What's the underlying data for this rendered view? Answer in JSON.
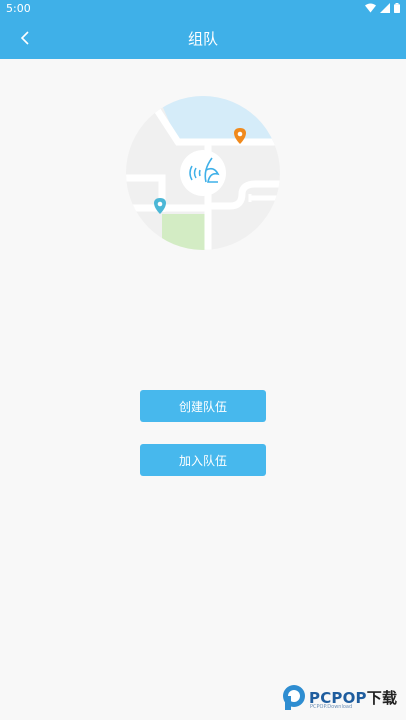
{
  "status_bar": {
    "time": "5:00"
  },
  "app_bar": {
    "title": "组队",
    "back_icon": "chevron-left-icon"
  },
  "illustration": {
    "icon": "team-location-map-icon"
  },
  "actions": {
    "create_team": "创建队伍",
    "join_team": "加入队伍"
  },
  "watermark": {
    "brand": "PCPOP",
    "suffix": "下载",
    "sub": "PCPOP.Download"
  },
  "colors": {
    "primary": "#3fb0e8",
    "button": "#47b8ed",
    "background": "#f8f8f8"
  }
}
